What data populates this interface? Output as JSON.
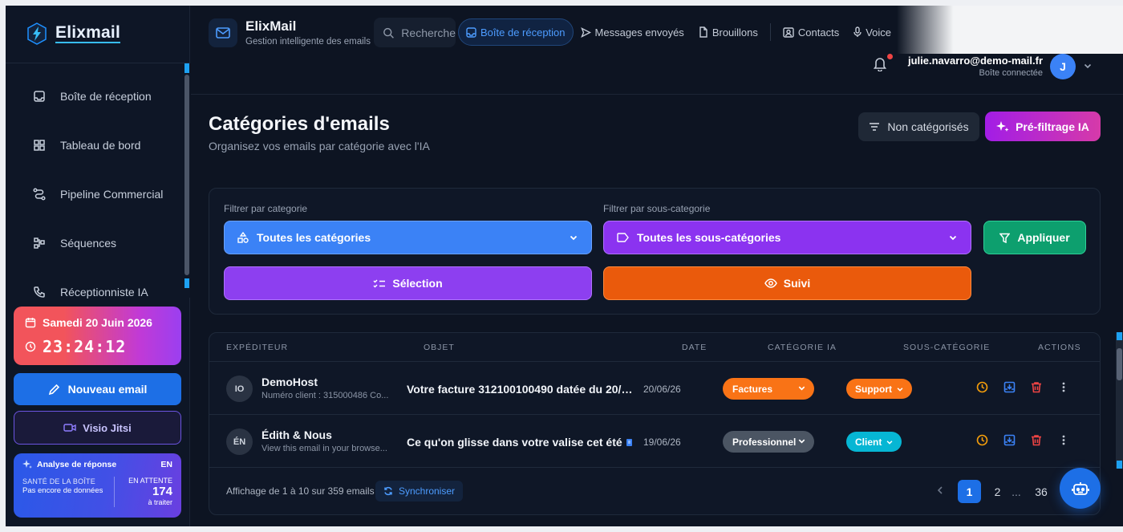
{
  "app": {
    "brand": "Elixmail",
    "title": "ElixMail",
    "subtitle": "Gestion intelligente des emails"
  },
  "search": {
    "placeholder": "Recherche"
  },
  "tabs": [
    {
      "label": "Boîte de réception",
      "icon": "inbox-icon",
      "active": true
    },
    {
      "label": "Messages envoyés",
      "icon": "send-icon"
    },
    {
      "label": "Brouillons",
      "icon": "file-icon"
    },
    {
      "label": "Contacts",
      "icon": "contact-card-icon"
    },
    {
      "label": "Voice",
      "icon": "mic-icon"
    }
  ],
  "user": {
    "email": "julie.navarro@demo-mail.fr",
    "status": "Boîte connectée",
    "initial": "J"
  },
  "sidebar": {
    "items": [
      {
        "label": "Boîte de réception",
        "icon": "inbox-icon"
      },
      {
        "label": "Tableau de bord",
        "icon": "dashboard-icon"
      },
      {
        "label": "Pipeline Commercial",
        "icon": "pipeline-icon"
      },
      {
        "label": "Séquences",
        "icon": "sequence-icon"
      },
      {
        "label": "Réceptionniste IA",
        "icon": "phone-icon"
      }
    ],
    "date": "Samedi 20 Juin 2026",
    "time": "23:24:12",
    "new_email": "Nouveau email",
    "visio": "Visio Jitsi",
    "health": {
      "title": "Analyse de réponse",
      "lang": "EN",
      "box_health_label": "SANTÉ DE LA BOÎTE",
      "box_health_value": "Pas encore de données",
      "pending_label": "EN ATTENTE",
      "pending_count": "174",
      "pending_suffix": "à traiter"
    }
  },
  "page": {
    "title": "Catégories d'emails",
    "subtitle": "Organisez vos emails par catégorie avec l'IA",
    "uncategorized_btn": "Non catégorisés",
    "ai_btn": "Pré-filtrage IA"
  },
  "filters": {
    "cat_label": "Filtrer par categorie",
    "cat_value": "Toutes les catégories",
    "sub_label": "Filtrer par sous-categorie",
    "sub_value": "Toutes les sous-catégories",
    "apply": "Appliquer",
    "selection": "Sélection",
    "follow": "Suivi"
  },
  "table": {
    "headers": {
      "sender": "EXPÉDITEUR",
      "subject": "OBJET",
      "date": "DATE",
      "category": "CATÉGORIE IA",
      "subcategory": "SOUS-CATÉGORIE",
      "actions": "ACTIONS"
    },
    "rows": [
      {
        "initials": "IO",
        "sender": "DemoHost",
        "preview": "Numéro client : 315000486 Co...",
        "subject": "Votre facture 312100100490 datée du 20/06...",
        "date": "20/06/26",
        "category": "Factures",
        "category_color": "#f97316",
        "subcategory": "Support",
        "subcategory_color": "#f97316"
      },
      {
        "initials": "ÉN",
        "sender": "Édith & Nous",
        "preview": "View this email in your browse...",
        "subject": "Ce qu'on glisse dans votre valise cet été",
        "date": "19/06/26",
        "category": "Professionnel",
        "category_color": "#4b5563",
        "subcategory": "Client",
        "subcategory_color": "#06b6d4"
      }
    ],
    "footer": "Affichage de 1 à 10 sur 359 emails",
    "sync": "Synchroniser",
    "pages": {
      "current": "1",
      "next": "2",
      "ellipsis": "...",
      "last": "36"
    }
  }
}
